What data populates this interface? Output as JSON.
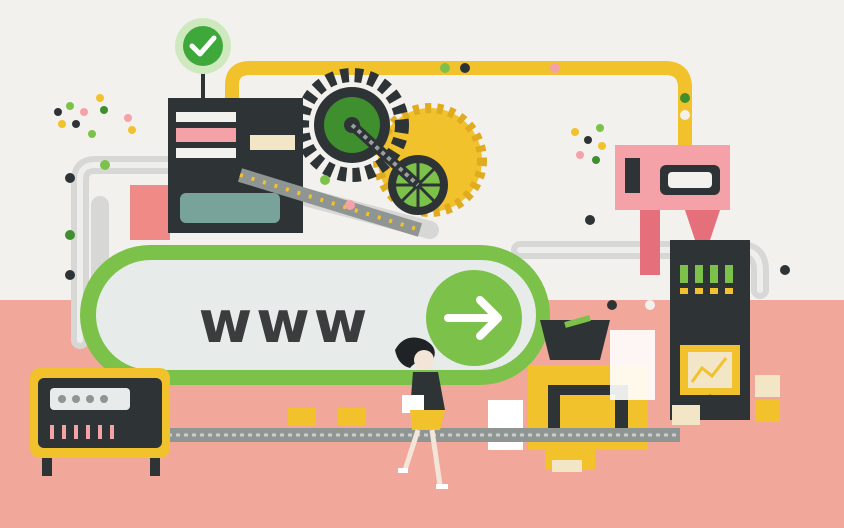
{
  "illustration": {
    "url_label": "www",
    "icons": [
      "check-icon",
      "arrow-right-icon",
      "gear-icon",
      "chart-icon"
    ],
    "colors": {
      "background": "#f3f1ee",
      "floor": "#f2a79b",
      "green": "#7cc24a",
      "dark_green": "#3f8f2f",
      "yellow": "#f1c22c",
      "charcoal": "#2e3436",
      "pink": "#f4a2a8",
      "pipe": "#dcdcdc"
    }
  }
}
